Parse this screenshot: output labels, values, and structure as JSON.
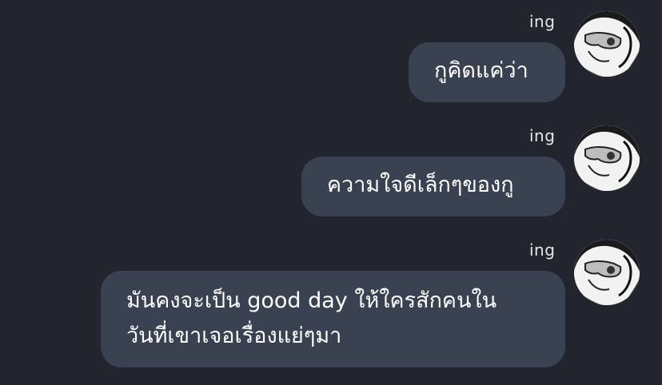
{
  "messages": [
    {
      "sender": "ing",
      "lines": [
        "กูคิดแค่ว่า"
      ]
    },
    {
      "sender": "ing",
      "lines": [
        "ความใจดีเล็กๆของกู"
      ]
    },
    {
      "sender": "ing",
      "lines": [
        "มันคงจะเป็น good day ให้ใครสักคนใน",
        "วันที่เขาเจอเรื่องแย่ๆมา"
      ]
    }
  ],
  "colors": {
    "background": "#22252d",
    "bubble": "#3a4252",
    "text": "#ffffff"
  },
  "icons": [
    "avatar-sunglasses-character"
  ]
}
